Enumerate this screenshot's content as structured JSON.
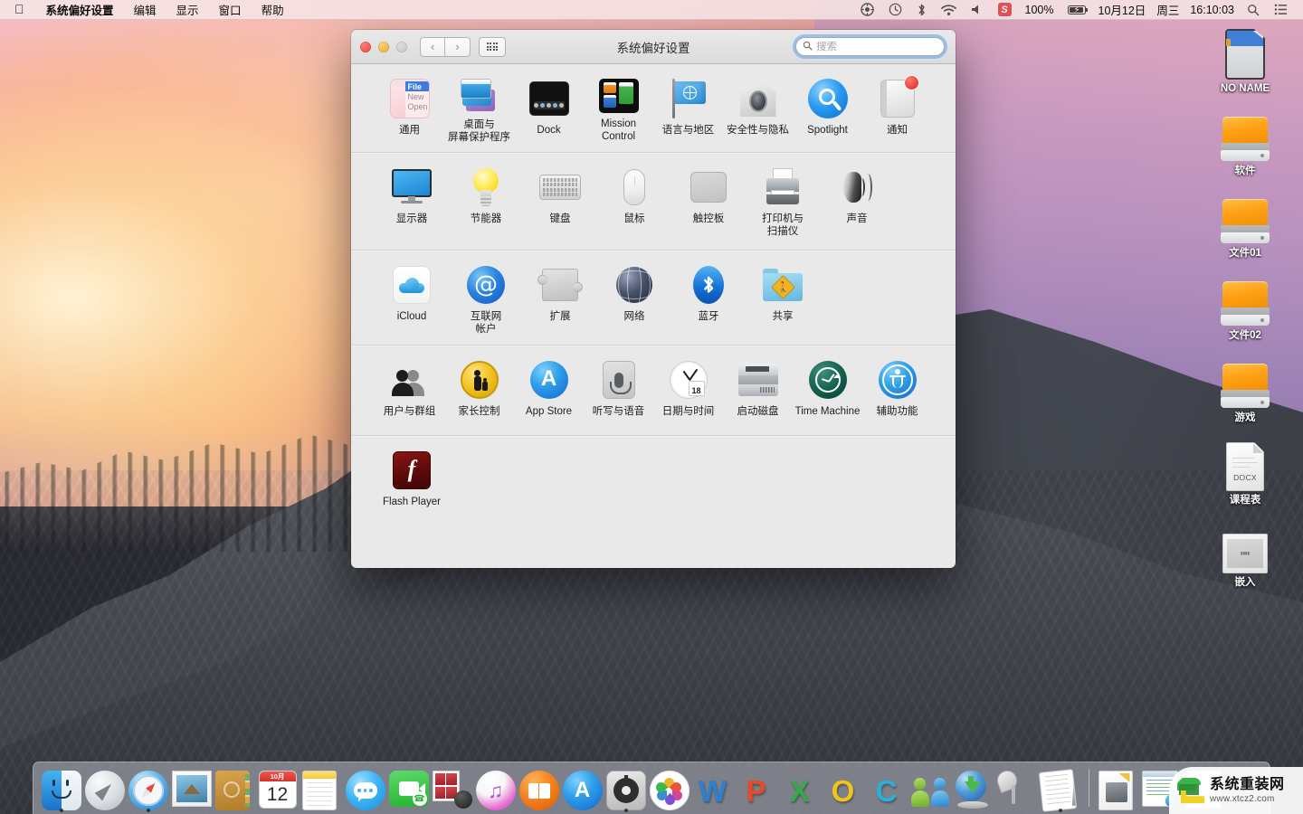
{
  "menubar": {
    "apple_icon": "apple-logo-icon",
    "items": [
      {
        "label": "系统偏好设置",
        "bold": true
      },
      {
        "label": "编辑",
        "bold": false
      },
      {
        "label": "显示",
        "bold": false
      },
      {
        "label": "窗口",
        "bold": false
      },
      {
        "label": "帮助",
        "bold": false
      }
    ],
    "status": {
      "sync_icon": "sync-circle-icon",
      "timemachine_icon": "time-machine-icon",
      "bluetooth_icon": "bluetooth-icon",
      "wifi_icon": "wifi-icon",
      "volume_icon": "volume-icon",
      "input_method": "S",
      "battery_percent": "100%",
      "battery_icon": "battery-charging-icon",
      "date": "10月12日",
      "weekday": "周三",
      "time": "16:10:03",
      "spotlight_icon": "search-icon",
      "notification_icon": "notification-center-icon"
    }
  },
  "window": {
    "title": "系统偏好设置",
    "traffic": {
      "close": "close-button",
      "minimize": "minimize-button",
      "zoom": "zoom-button"
    },
    "nav": {
      "back": "‹",
      "forward": "›",
      "grid": "show-all-button"
    },
    "search": {
      "placeholder": "搜索",
      "value": "",
      "icon": "search-icon",
      "clear": "clear-icon"
    },
    "rows": [
      [
        {
          "label": "通用",
          "icon": "general-icon",
          "art": "general"
        },
        {
          "label": "桌面与\n屏幕保护程序",
          "icon": "desktop-screensaver-icon",
          "art": "desktop"
        },
        {
          "label": "Dock",
          "icon": "dock-icon",
          "art": "dock"
        },
        {
          "label": "Mission\nControl",
          "icon": "mission-control-icon",
          "art": "mission"
        },
        {
          "label": "语言与地区",
          "icon": "language-region-icon",
          "art": "lang"
        },
        {
          "label": "安全性与隐私",
          "icon": "security-privacy-icon",
          "art": "sec"
        },
        {
          "label": "Spotlight",
          "icon": "spotlight-icon",
          "art": "spot"
        },
        {
          "label": "通知",
          "icon": "notifications-icon",
          "art": "notif"
        }
      ],
      [
        {
          "label": "显示器",
          "icon": "displays-icon",
          "art": "display"
        },
        {
          "label": "节能器",
          "icon": "energy-saver-icon",
          "art": "energy"
        },
        {
          "label": "键盘",
          "icon": "keyboard-icon",
          "art": "kb"
        },
        {
          "label": "鼠标",
          "icon": "mouse-icon",
          "art": "mouse"
        },
        {
          "label": "触控板",
          "icon": "trackpad-icon",
          "art": "track"
        },
        {
          "label": "打印机与\n扫描仪",
          "icon": "printers-scanners-icon",
          "art": "print"
        },
        {
          "label": "声音",
          "icon": "sound-icon",
          "art": "sound"
        }
      ],
      [
        {
          "label": "iCloud",
          "icon": "icloud-icon",
          "art": "icloud"
        },
        {
          "label": "互联网\n帐户",
          "icon": "internet-accounts-icon",
          "art": "at"
        },
        {
          "label": "扩展",
          "icon": "extensions-icon",
          "art": "ext"
        },
        {
          "label": "网络",
          "icon": "network-icon",
          "art": "net"
        },
        {
          "label": "蓝牙",
          "icon": "bluetooth-icon",
          "art": "bt"
        },
        {
          "label": "共享",
          "icon": "sharing-icon",
          "art": "share"
        }
      ],
      [
        {
          "label": "用户与群组",
          "icon": "users-groups-icon",
          "art": "users"
        },
        {
          "label": "家长控制",
          "icon": "parental-controls-icon",
          "art": "parent"
        },
        {
          "label": "App Store",
          "icon": "app-store-icon",
          "art": "appstore"
        },
        {
          "label": "听写与语音",
          "icon": "dictation-speech-icon",
          "art": "dict"
        },
        {
          "label": "日期与时间",
          "icon": "date-time-icon",
          "art": "clock",
          "day": "18"
        },
        {
          "label": "启动磁盘",
          "icon": "startup-disk-icon",
          "art": "disk"
        },
        {
          "label": "Time Machine",
          "icon": "time-machine-icon",
          "art": "tm"
        },
        {
          "label": "辅助功能",
          "icon": "accessibility-icon",
          "art": "access"
        }
      ],
      [
        {
          "label": "Flash Player",
          "icon": "flash-player-icon",
          "art": "flash"
        }
      ]
    ]
  },
  "desktop_icons": [
    {
      "label": "NO NAME",
      "icon": "sd-card-icon",
      "art": "sd"
    },
    {
      "label": "软件",
      "icon": "hard-drive-icon",
      "art": "hdd"
    },
    {
      "label": "文件01",
      "icon": "hard-drive-icon",
      "art": "hdd"
    },
    {
      "label": "文件02",
      "icon": "hard-drive-icon",
      "art": "hdd"
    },
    {
      "label": "游戏",
      "icon": "hard-drive-icon",
      "art": "hdd"
    },
    {
      "label": "课程表",
      "icon": "docx-file-icon",
      "art": "doc",
      "ext": "DOCX"
    },
    {
      "label": "嵌入",
      "icon": "document-icon",
      "art": "emb"
    }
  ],
  "dock": {
    "items": [
      {
        "name": "finder",
        "art": "finder",
        "running": true
      },
      {
        "name": "launchpad",
        "art": "launch",
        "running": false
      },
      {
        "name": "safari",
        "art": "safari",
        "running": true
      },
      {
        "name": "mail",
        "art": "mail",
        "running": false
      },
      {
        "name": "contacts",
        "art": "contacts",
        "running": false
      },
      {
        "name": "calendar",
        "art": "cal",
        "running": false,
        "month": "10月",
        "day": "12"
      },
      {
        "name": "notes",
        "art": "notes",
        "running": false
      },
      {
        "name": "messages",
        "art": "msg",
        "running": false
      },
      {
        "name": "facetime",
        "art": "facetime",
        "running": false
      },
      {
        "name": "photo-booth",
        "art": "booth",
        "running": false
      },
      {
        "name": "itunes",
        "art": "itunes",
        "running": false
      },
      {
        "name": "ibooks",
        "art": "ibooks",
        "running": false
      },
      {
        "name": "app-store",
        "art": "appstore",
        "running": false
      },
      {
        "name": "system-preferences",
        "art": "sysprefs",
        "running": true
      },
      {
        "name": "photos",
        "art": "photos",
        "running": false
      },
      {
        "name": "microsoft-word",
        "art": "letter",
        "letter": "W",
        "color": "#2f7fd0",
        "running": false
      },
      {
        "name": "microsoft-powerpoint",
        "art": "letter",
        "letter": "P",
        "color": "#e8492b",
        "running": false
      },
      {
        "name": "microsoft-excel",
        "art": "letter",
        "letter": "X",
        "color": "#3aa84a",
        "running": false
      },
      {
        "name": "microsoft-outlook",
        "art": "letter",
        "letter": "O",
        "color": "#f0c419",
        "running": false
      },
      {
        "name": "microsoft-communicator",
        "art": "letter",
        "letter": "C",
        "color": "#2ab0d8",
        "running": false
      },
      {
        "name": "microsoft-messenger",
        "art": "msn",
        "running": false
      },
      {
        "name": "downloads",
        "art": "download",
        "running": false
      },
      {
        "name": "remote-desktop",
        "art": "rdp",
        "running": false
      },
      {
        "name": "textedit",
        "art": "textedit",
        "running": true
      },
      {
        "name": "separator",
        "art": "sep",
        "running": false
      },
      {
        "name": "document-a",
        "art": "docA",
        "running": false
      },
      {
        "name": "document-b",
        "art": "docB",
        "running": false
      },
      {
        "name": "document-c",
        "art": "docC",
        "running": false
      }
    ]
  },
  "watermark": {
    "title": "系统重装网",
    "url": "www.xtcz2.com",
    "logo": "recycle-logo-icon"
  }
}
